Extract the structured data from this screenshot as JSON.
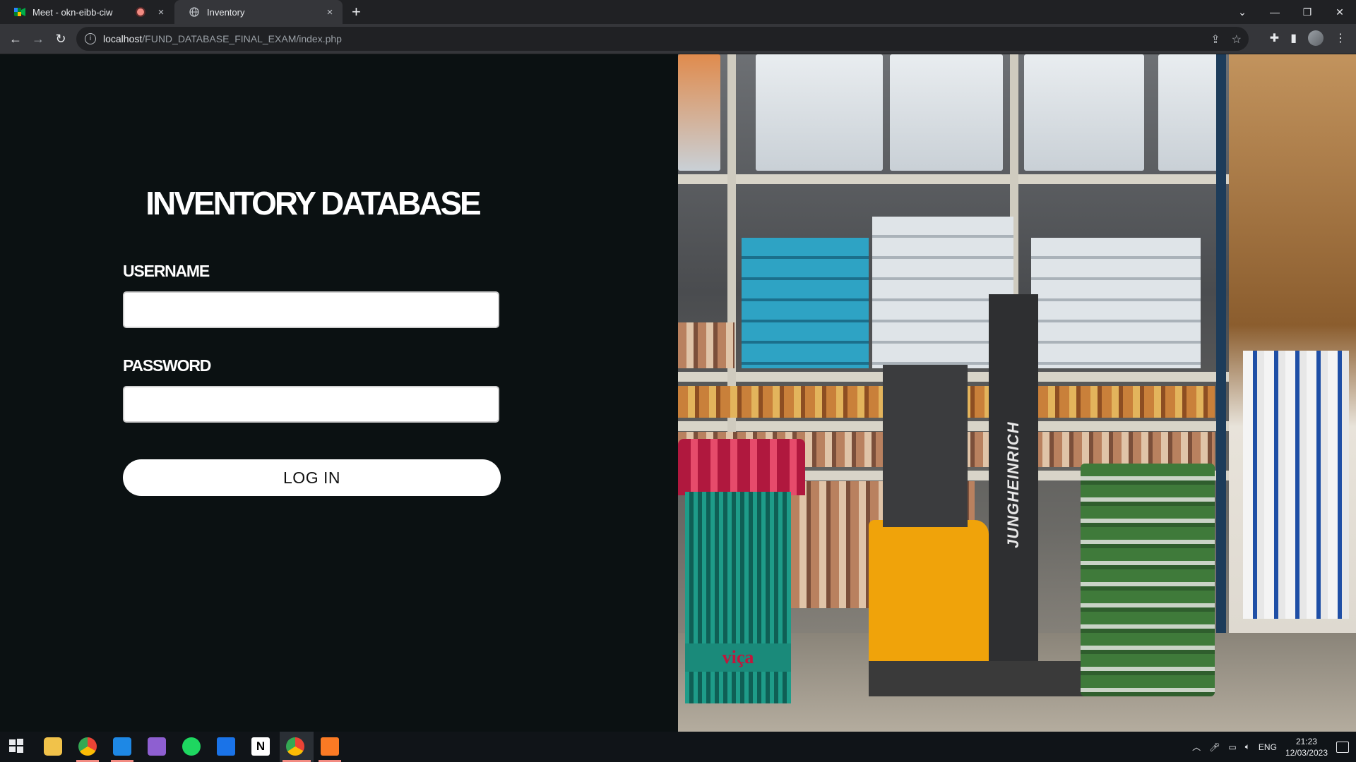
{
  "browser": {
    "tabs": [
      {
        "title": "Meet - okn-eibb-ciw",
        "close": "×",
        "recording": true
      },
      {
        "title": "Inventory",
        "close": "×",
        "active": true
      }
    ],
    "new_tab": "+",
    "url_host": "localhost",
    "url_path": "/FUND_DATABASE_FINAL_EXAM/index.php",
    "window_controls": {
      "dropdown": "⌄",
      "minimize": "—",
      "restore": "❐",
      "close": "✕"
    }
  },
  "login": {
    "title": "INVENTORY DATABASE",
    "username_label": "USERNAME",
    "username_value": "",
    "password_label": "PASSWORD",
    "password_value": "",
    "login_button": "LOG IN"
  },
  "photo": {
    "brand_text": "JUNGHEINRICH",
    "sign_text": "viça"
  },
  "taskbar": {
    "apps": [
      "windows-start",
      "file-explorer",
      "chrome",
      "vscode",
      "visual-studio",
      "spotify",
      "mail",
      "notion",
      "chrome-active",
      "xampp"
    ],
    "lang": "ENG",
    "time": "21:23",
    "date": "12/03/2023"
  },
  "colors": {
    "page_bg": "#0b1112",
    "button_bg": "#ffffff",
    "text": "#ffffff"
  }
}
